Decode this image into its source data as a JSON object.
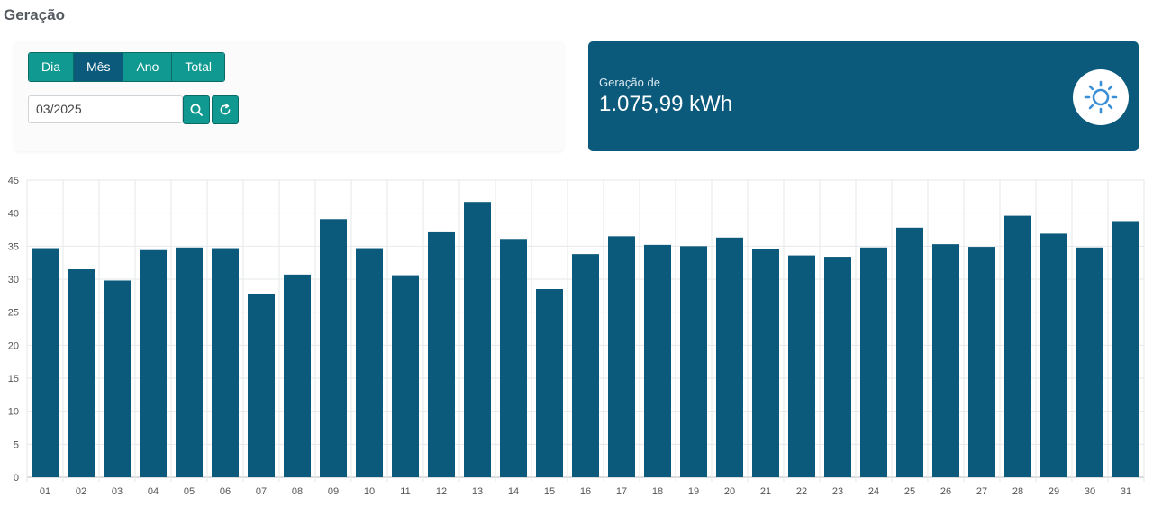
{
  "page": {
    "title": "Geração"
  },
  "filters": {
    "periods": [
      "Dia",
      "Mês",
      "Ano",
      "Total"
    ],
    "active_period": "Mês",
    "date_value": "03/2025",
    "search_icon": "search-icon",
    "refresh_icon": "refresh-icon"
  },
  "summary": {
    "label": "Geração de",
    "value": "1.075,99 kWh",
    "icon": "sun-icon"
  },
  "colors": {
    "accent_teal": "#0f9990",
    "primary_blue": "#0b5a7c",
    "sun_blue": "#3a8fd6"
  },
  "chart_data": {
    "type": "bar",
    "categories": [
      "01",
      "02",
      "03",
      "04",
      "05",
      "06",
      "07",
      "08",
      "09",
      "10",
      "11",
      "12",
      "13",
      "14",
      "15",
      "16",
      "17",
      "18",
      "19",
      "20",
      "21",
      "22",
      "23",
      "24",
      "25",
      "26",
      "27",
      "28",
      "29",
      "30",
      "31"
    ],
    "values": [
      34.7,
      31.5,
      29.8,
      34.4,
      34.8,
      34.7,
      27.7,
      30.7,
      39.1,
      34.7,
      30.6,
      37.1,
      41.7,
      36.1,
      28.5,
      33.8,
      36.5,
      35.2,
      35.0,
      36.3,
      34.6,
      33.6,
      33.4,
      34.8,
      37.8,
      35.3,
      34.9,
      39.6,
      36.9,
      34.8,
      38.8
    ],
    "title": "",
    "xlabel": "",
    "ylabel": "",
    "ylim": [
      0,
      45
    ],
    "yticks": [
      0,
      5,
      10,
      15,
      20,
      25,
      30,
      35,
      40,
      45
    ],
    "grid": true,
    "bar_color": "#0b5a7c"
  }
}
